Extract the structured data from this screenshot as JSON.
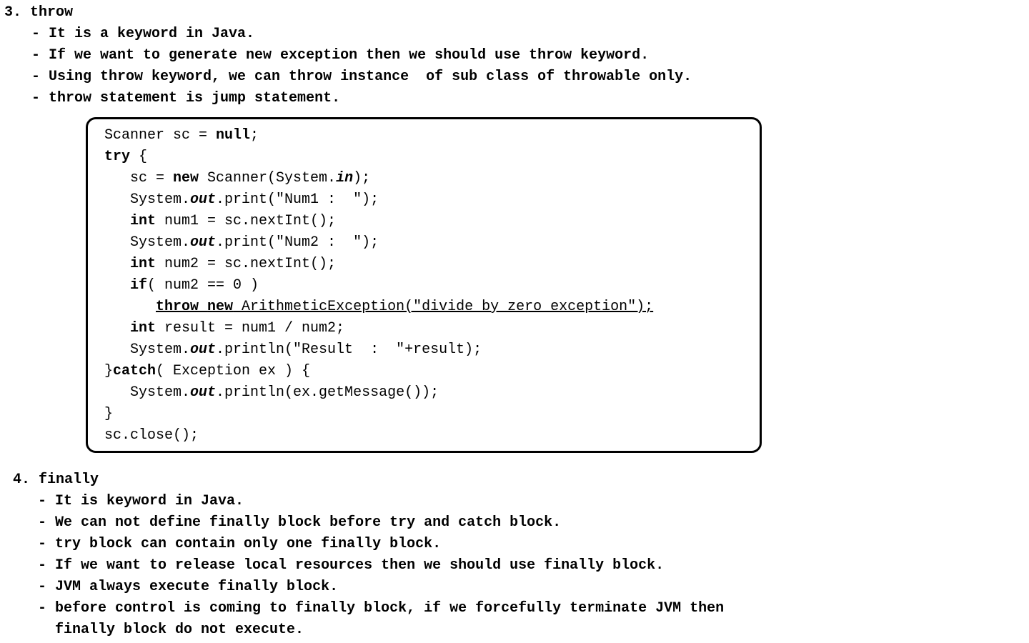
{
  "section3": {
    "heading": "3. throw",
    "bullets": [
      "- It is a keyword in Java.",
      "- If we want to generate new exception then we should use throw keyword.",
      "- Using throw keyword, we can throw instance  of sub class of throwable only.",
      "- throw statement is jump statement."
    ]
  },
  "code": {
    "l1": {
      "a": "Scanner sc = ",
      "b": "null",
      "c": ";"
    },
    "l2": {
      "a": "try",
      "b": " {"
    },
    "l3": {
      "a": "sc = ",
      "b": "new",
      "c": " Scanner(System.",
      "d": "in",
      "e": ");"
    },
    "l4": {
      "a": "System.",
      "b": "out",
      "c": ".print(\"Num1 :  \");"
    },
    "l5": {
      "a": "int",
      "b": " num1 = sc.nextInt();"
    },
    "l6": {
      "a": "System.",
      "b": "out",
      "c": ".print(\"Num2 :  \");"
    },
    "l7": {
      "a": "int",
      "b": " num2 = sc.nextInt();"
    },
    "l8": {
      "a": "if",
      "b": "( num2 == 0 )"
    },
    "l9": {
      "a": "throw",
      "b": " ",
      "c": "new",
      "d": " ArithmeticException(\"divide by zero exception\");"
    },
    "l10": {
      "a": "int",
      "b": " result = num1 / num2;"
    },
    "l11": {
      "a": "System.",
      "b": "out",
      "c": ".println(\"Result  :  \"+result);"
    },
    "l12": {
      "a": "}",
      "b": "catch",
      "c": "( Exception ex ) {"
    },
    "l13": {
      "a": "System.",
      "b": "out",
      "c": ".println(ex.getMessage());"
    },
    "l14": {
      "a": "}"
    },
    "l15": {
      "a": "sc.close();"
    }
  },
  "section4": {
    "heading": "4. finally",
    "bullets": [
      "- It is keyword in Java.",
      "- We can not define finally block before try and catch block.",
      "- try block can contain only one finally block.",
      "- If we want to release local resources then we should use finally block.",
      "- JVM always execute finally block.",
      "- before control is coming to finally block, if we forcefully terminate JVM then",
      "  finally block do not execute."
    ]
  }
}
